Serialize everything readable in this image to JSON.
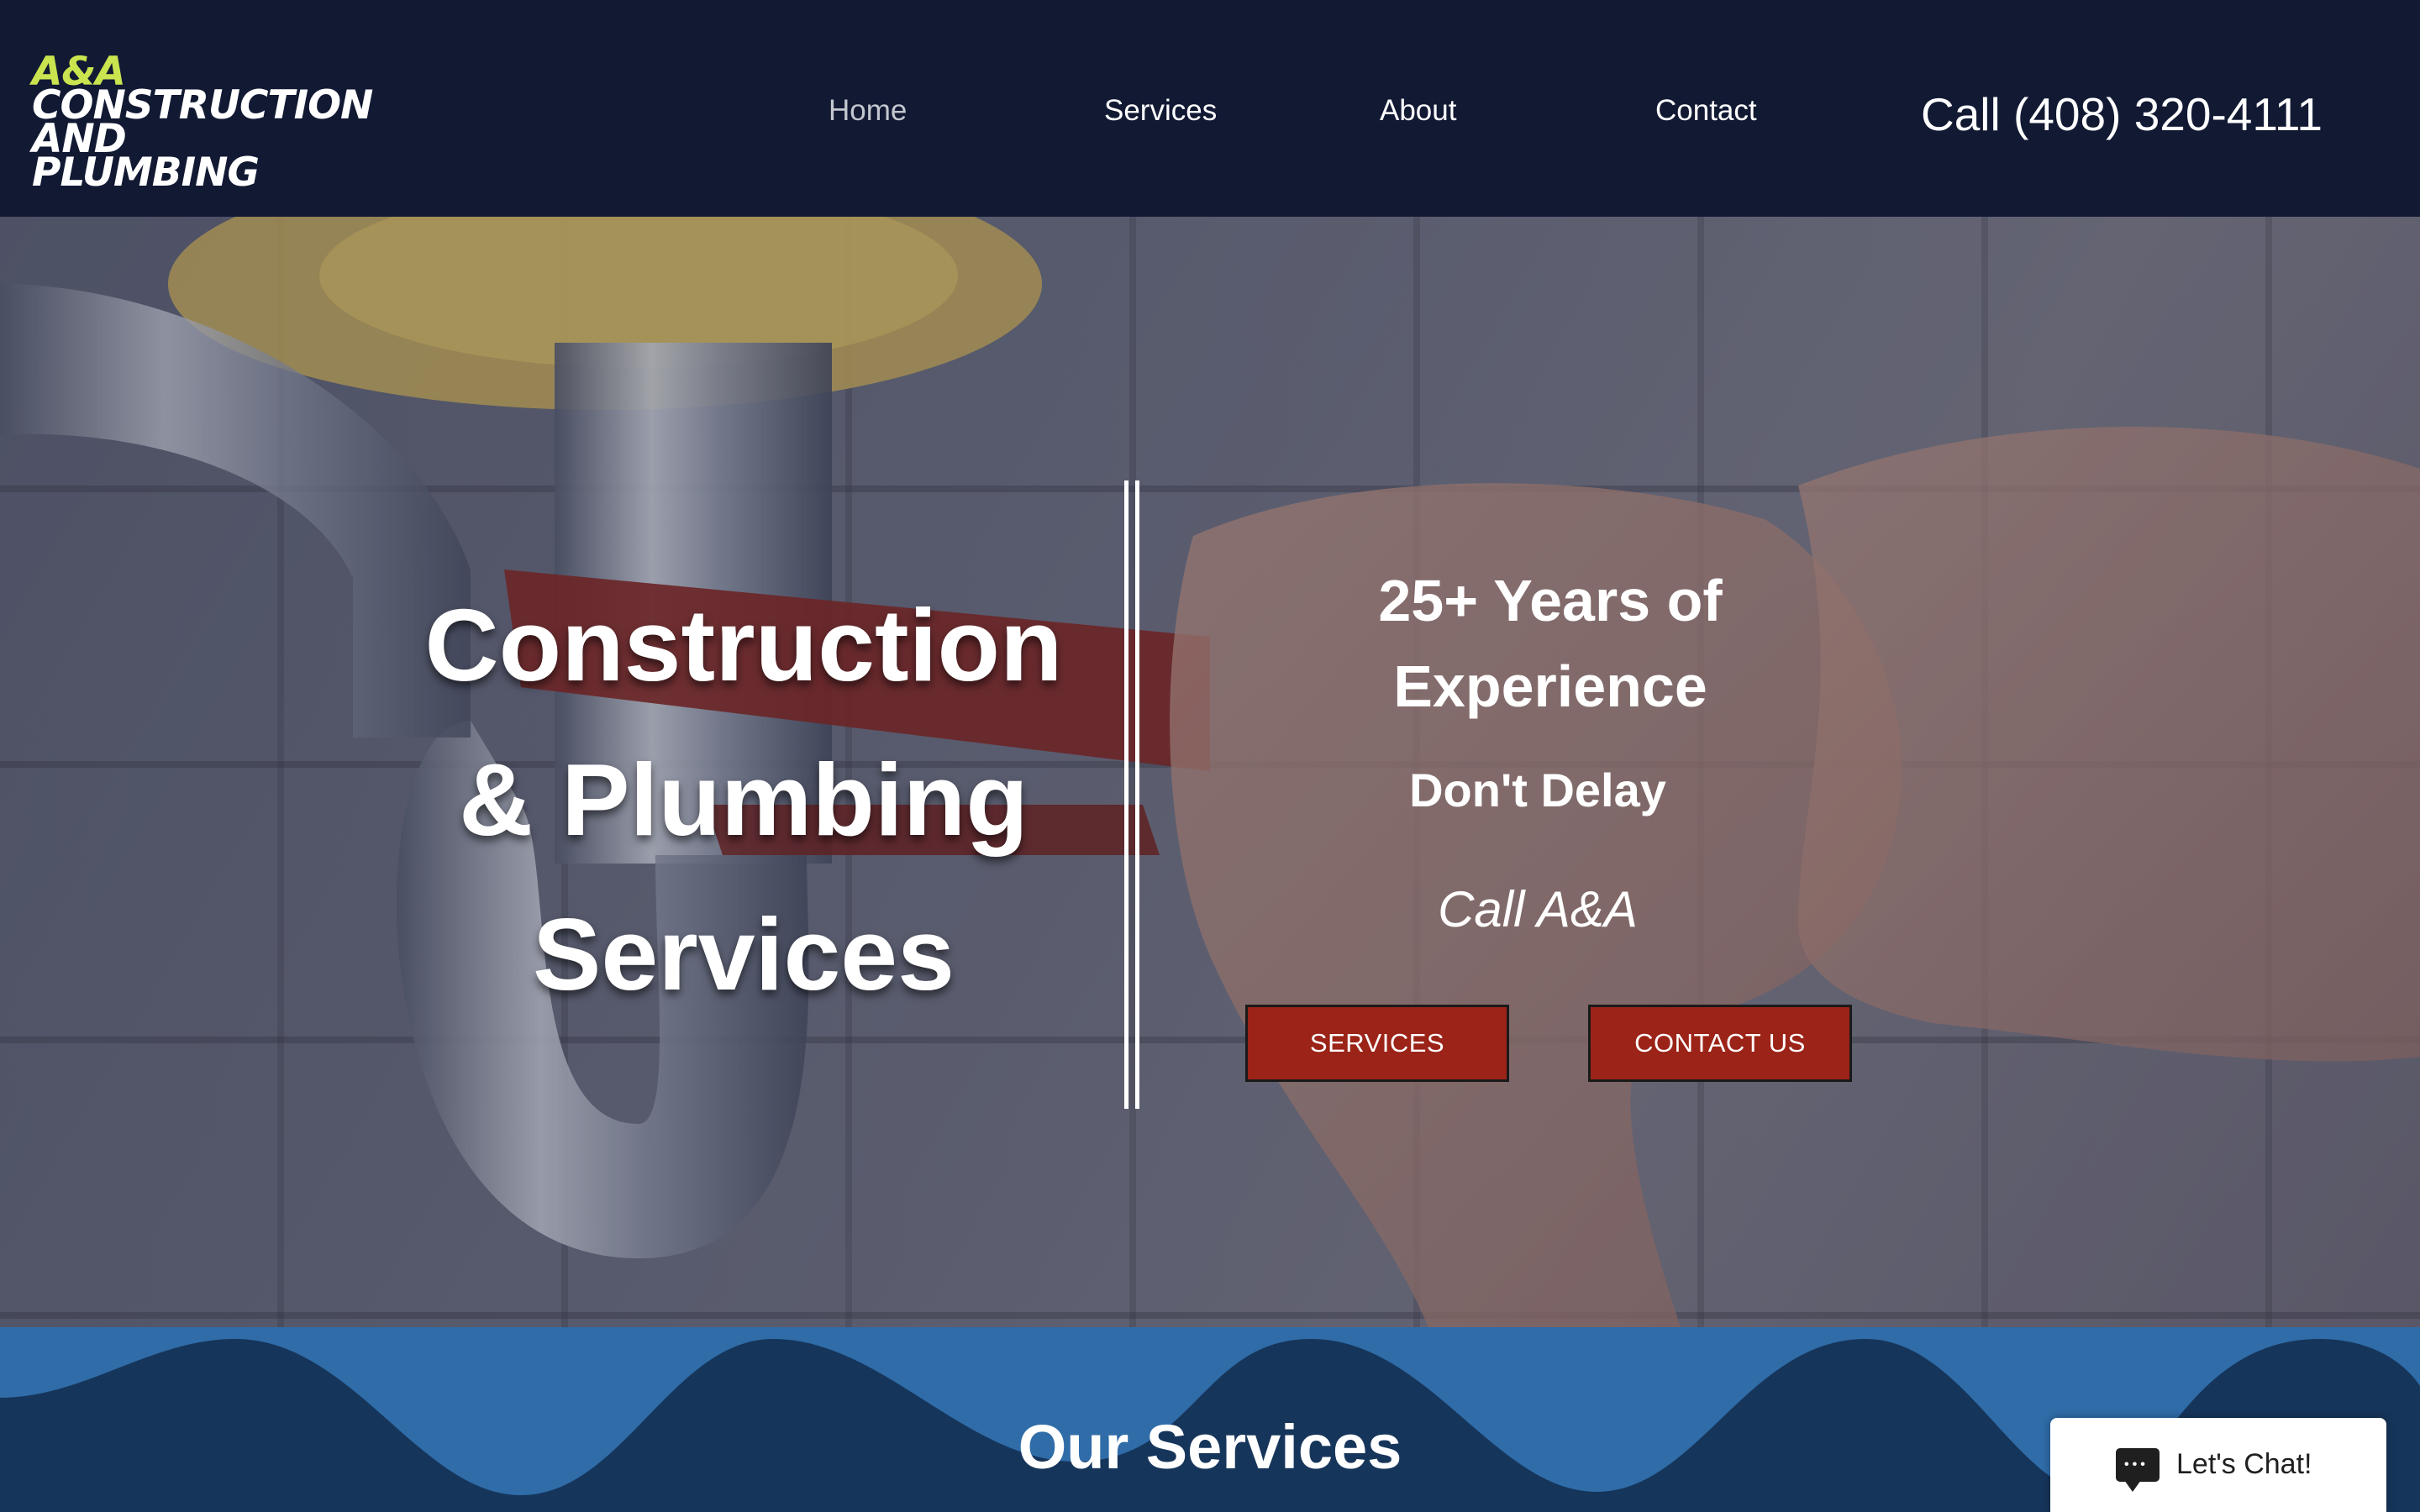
{
  "header": {
    "logo_lines": [
      "A&A",
      "CONSTRUCTION",
      "AND",
      "PLUMBING"
    ],
    "nav": [
      "Home",
      "Services",
      "About",
      "Contact"
    ],
    "active_nav": "Home",
    "phone": "Call (408) 320-4111"
  },
  "hero": {
    "title_lines": [
      "Construction",
      "& Plumbing",
      "Services"
    ],
    "experience_lines": [
      "25+ Years of",
      "Experience"
    ],
    "tagline": "Don't Delay",
    "call": "Call A&A",
    "buttons": [
      "SERVICES",
      "CONTACT US"
    ]
  },
  "services": {
    "title": "Our Services"
  },
  "chat": {
    "label": "Let's Chat!"
  },
  "colors": {
    "header_bg": "#121933",
    "logo_accent": "#c9e44f",
    "button_red": "#9b2318",
    "wave_dark": "#16355a",
    "wave_light": "#2f6ca8"
  }
}
